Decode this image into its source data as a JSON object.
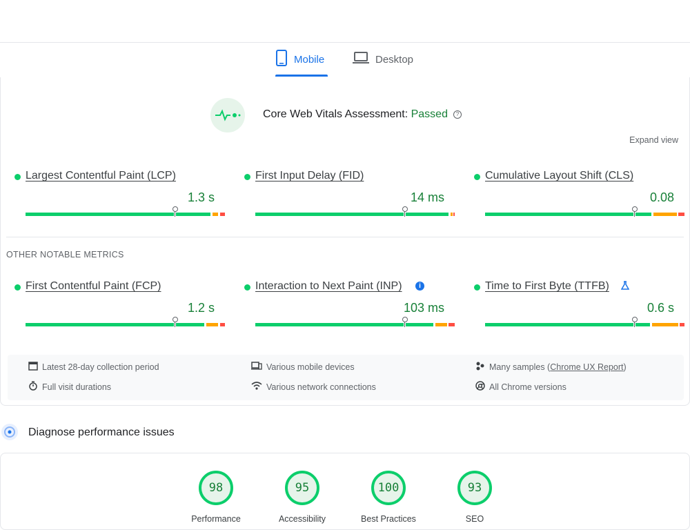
{
  "tabs": [
    {
      "label": "Mobile",
      "icon": "phone-icon",
      "active": true
    },
    {
      "label": "Desktop",
      "icon": "laptop-icon",
      "active": false
    }
  ],
  "assessment": {
    "prefix": "Core Web Vitals Assessment: ",
    "status": "Passed",
    "help_icon": "help-icon",
    "expand_label": "Expand view"
  },
  "core_metrics": [
    {
      "name": "Largest Contentful Paint (LCP)",
      "value": "1.3 s",
      "status": "good"
    },
    {
      "name": "First Input Delay (FID)",
      "value": "14 ms",
      "status": "good"
    },
    {
      "name": "Cumulative Layout Shift (CLS)",
      "value": "0.08",
      "status": "good"
    }
  ],
  "other_metrics_label": "OTHER NOTABLE METRICS",
  "other_metrics": [
    {
      "name": "First Contentful Paint (FCP)",
      "value": "1.2 s",
      "status": "good"
    },
    {
      "name": "Interaction to Next Paint (INP)",
      "value": "103 ms",
      "status": "good",
      "badge_icon": "info-icon"
    },
    {
      "name": "Time to First Byte (TTFB)",
      "value": "0.6 s",
      "status": "good",
      "badge_icon": "flask-icon"
    }
  ],
  "info": {
    "collection_period": "Latest 28-day collection period",
    "devices": "Various mobile devices",
    "samples_prefix": "Many samples (",
    "samples_link": "Chrome UX Report",
    "samples_suffix": ")",
    "durations": "Full visit durations",
    "network": "Various network connections",
    "chrome_versions": "All Chrome versions"
  },
  "diagnose_title": "Diagnose performance issues",
  "scores": [
    {
      "value": "98",
      "label": "Performance"
    },
    {
      "value": "95",
      "label": "Accessibility"
    },
    {
      "value": "100",
      "label": "Best Practices"
    },
    {
      "value": "93",
      "label": "SEO"
    }
  ],
  "colors": {
    "good": "#0cce6b",
    "average": "#ffa400",
    "poor": "#ff4e42",
    "accent": "#1a73e8",
    "passed_text": "#188038"
  }
}
